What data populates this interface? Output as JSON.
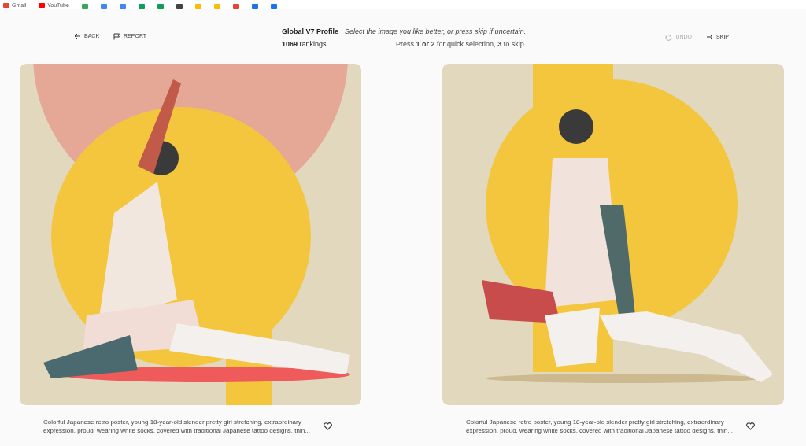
{
  "bookmarks": [
    {
      "label": "Gmail",
      "color": "#ea4335"
    },
    {
      "label": "YouTube",
      "color": "#ff0000"
    },
    {
      "color": "#34a853"
    },
    {
      "color": "#4285f4"
    },
    {
      "color": "#4285f4"
    },
    {
      "color": "#0f9d58"
    },
    {
      "color": "#0f9d58"
    },
    {
      "color": "#444444"
    },
    {
      "color": "#fbbc05"
    },
    {
      "color": "#fbbc05"
    },
    {
      "color": "#ea4335"
    },
    {
      "color": "#1a73e8"
    },
    {
      "color": "#1a73e8"
    }
  ],
  "nav": {
    "back": "BACK",
    "report": "REPORT",
    "undo": "UNDO",
    "undo_disabled": true,
    "skip": "SKIP"
  },
  "profile": {
    "title": "Global V7 Profile",
    "count": "1069",
    "count_label": "rankings"
  },
  "instructions": {
    "prompt": "Select the image you like better, or press skip if uncertain.",
    "keys": "Press **1 or 2** for quick selection, **3** to skip."
  },
  "options": [
    {
      "caption": "Colorful Japanese retro poster, young 18-year-old slender pretty girl stretching, extraordinary expression, proud, wearing white socks, covered with traditional Japanese tattoo designs, thin...",
      "liked": false
    },
    {
      "caption": "Colorful Japanese retro poster, young 18-year-old slender pretty girl stretching, extraordinary expression, proud, wearing white socks, covered with traditional Japanese tattoo designs, thin...",
      "liked": false
    }
  ]
}
